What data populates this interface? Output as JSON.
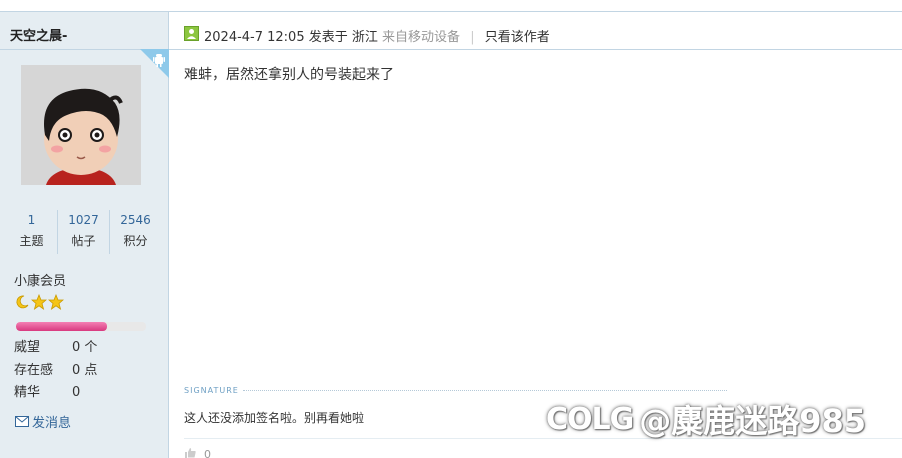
{
  "author": {
    "name": "天空之晨-",
    "stats": [
      {
        "value": "1",
        "label": "主题"
      },
      {
        "value": "1027",
        "label": "帖子"
      },
      {
        "value": "2546",
        "label": "积分"
      }
    ],
    "rank": "小康会员",
    "level_progress_percent": 70,
    "credits": [
      {
        "label": "威望",
        "value": "0 个"
      },
      {
        "label": "存在感",
        "value": "0 点"
      },
      {
        "label": "精华",
        "value": "0"
      }
    ],
    "send_message_label": "发消息"
  },
  "post": {
    "datetime": "2024-4-7 12:05",
    "posted_in": "发表于 浙江",
    "via": "来自移动设备",
    "separator": "|",
    "only_author_label": "只看该作者",
    "content": "难蚌，居然还拿别人的号装起来了",
    "signature_title": "SIGNATURE",
    "signature": "这人还没添加签名啦。别再看她啦",
    "like_count": "0"
  },
  "watermark": {
    "logo": "COLG",
    "text": "@麋鹿迷路985"
  },
  "colors": {
    "accent": "#336699",
    "sidebar_bg": "#e5edf2",
    "border": "#c2d5e3",
    "online": "#8cc63f",
    "progress": "#e05592"
  }
}
